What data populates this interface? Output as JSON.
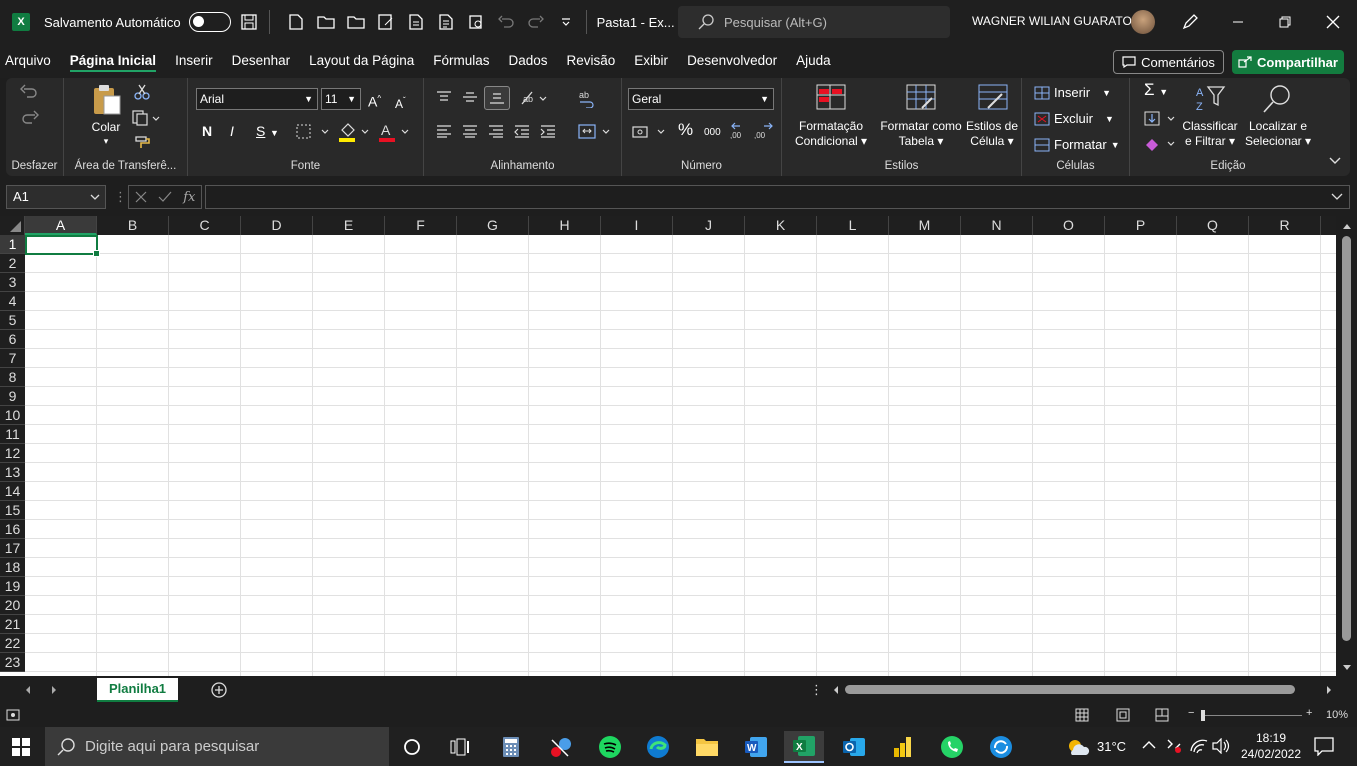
{
  "titlebar": {
    "autosave_label": "Salvamento Automático",
    "doc_name": "Pasta1  -  Ex...",
    "search_placeholder": "Pesquisar (Alt+G)",
    "user_name": "WAGNER WILIAN GUARATO"
  },
  "menu": {
    "items": [
      "Arquivo",
      "Página Inicial",
      "Inserir",
      "Desenhar",
      "Layout da Página",
      "Fórmulas",
      "Dados",
      "Revisão",
      "Exibir",
      "Desenvolvedor",
      "Ajuda"
    ],
    "comments_label": "Comentários",
    "share_label": "Compartilhar"
  },
  "ribbon": {
    "undo_group": "Desfazer",
    "clipboard": {
      "paste_label": "Colar",
      "group": "Área de Transferê..."
    },
    "font": {
      "family": "Arial",
      "size": "11",
      "bold": "N",
      "italic": "I",
      "underline": "S",
      "group": "Fonte"
    },
    "alignment": {
      "group": "Alinhamento"
    },
    "number": {
      "format": "Geral",
      "percent": "%",
      "thousands": "000",
      "group": "Número"
    },
    "styles": {
      "conditional_l1": "Formatação",
      "conditional_l2": "Condicional",
      "table_l1": "Formatar como",
      "table_l2": "Tabela",
      "cell_l1": "Estilos de",
      "cell_l2": "Célula",
      "group": "Estilos"
    },
    "cells": {
      "insert": "Inserir",
      "delete": "Excluir",
      "format": "Formatar",
      "group": "Células"
    },
    "editing": {
      "sort_l1": "Classificar",
      "sort_l2": "e Filtrar",
      "find_l1": "Localizar e",
      "find_l2": "Selecionar",
      "group": "Edição"
    }
  },
  "formula_bar": {
    "name_box": "A1",
    "fx": "fx",
    "value": ""
  },
  "grid": {
    "columns": [
      "A",
      "B",
      "C",
      "D",
      "E",
      "F",
      "G",
      "H",
      "I",
      "J",
      "K",
      "L",
      "M",
      "N",
      "O",
      "P",
      "Q",
      "R"
    ],
    "rows": [
      "1",
      "2",
      "3",
      "4",
      "5",
      "6",
      "7",
      "8",
      "9",
      "10",
      "11",
      "12",
      "13",
      "14",
      "15",
      "16",
      "17",
      "18",
      "19",
      "20",
      "21",
      "22",
      "23"
    ],
    "selected_column": "A",
    "selected_row": "1"
  },
  "sheets": {
    "tabs": [
      "Planilha1"
    ],
    "active": "Planilha1"
  },
  "status": {
    "zoom": "10%"
  },
  "taskbar": {
    "search_placeholder": "Digite aqui para pesquisar",
    "temperature": "31°C",
    "time": "18:19",
    "date": "24/02/2022",
    "apps": [
      "cortana-icon",
      "task-view-icon",
      "calculator-icon",
      "snipping-icon",
      "spotify-icon",
      "edge-icon",
      "file-explorer-icon",
      "word-icon",
      "excel-icon",
      "outlook-icon",
      "power-bi-icon",
      "whatsapp-icon",
      "sync-icon"
    ]
  },
  "colors": {
    "accent": "#107c41",
    "ribbon_bg": "#292929",
    "window_bg": "#1e1e1e"
  }
}
